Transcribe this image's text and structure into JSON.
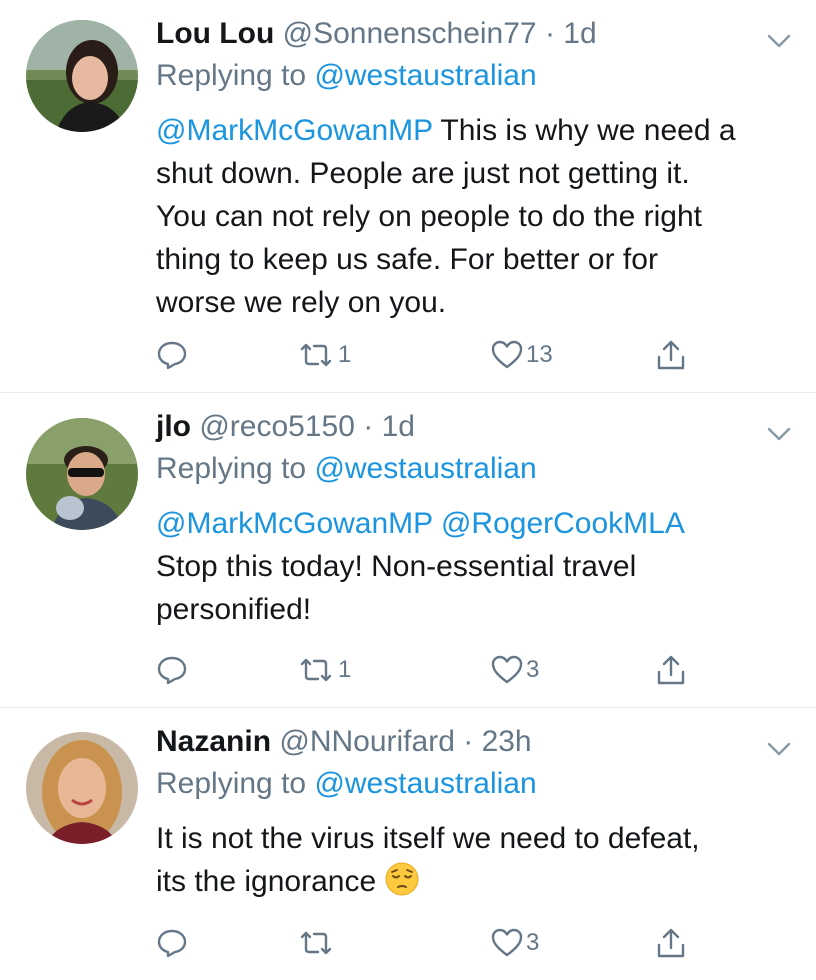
{
  "tweets": [
    {
      "name": "Lou Lou",
      "handle": "@Sonnenschein77",
      "sep": " · ",
      "time": "1d",
      "replying_label": "Replying to ",
      "replying_to": "@westaustralian",
      "body_mention": "@MarkMcGowanMP",
      "body_line1": " This is why we need a",
      "body_line2": "shut down. People are just not getting it.",
      "body_line3": "You can not rely on people to do the right",
      "body_line4": "thing to keep us safe. For better or for",
      "body_line5": "worse we rely on you.",
      "retweets": "1",
      "likes": "13"
    },
    {
      "name": "jlo",
      "handle": "@reco5150",
      "sep": " · ",
      "time": "1d",
      "replying_label": "Replying to ",
      "replying_to": "@westaustralian",
      "body_mention1": "@MarkMcGowanMP",
      "body_mention2": "@RogerCookMLA",
      "body_line2": "Stop this today! Non-essential travel",
      "body_line3": "personified!",
      "retweets": "1",
      "likes": "3"
    },
    {
      "name": "Nazanin",
      "handle": "@NNourifard",
      "sep": " · ",
      "time": "23h",
      "replying_label": "Replying to ",
      "replying_to": "@westaustralian",
      "body_line1": "It is not the virus itself we need to defeat,",
      "body_line2": "its the ignorance ",
      "emoji": "pensive-face",
      "retweets": "",
      "likes": "3"
    }
  ],
  "colors": {
    "link": "#1b95e0",
    "secondary": "#657786",
    "divider": "#e6ecf0",
    "text": "#14171a"
  }
}
